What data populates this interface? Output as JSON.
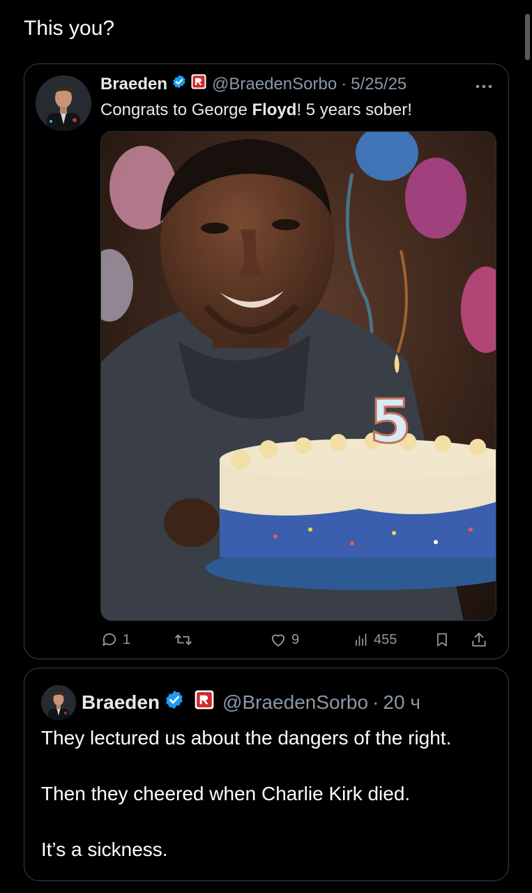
{
  "header": {
    "text": "This you?"
  },
  "quoted_tweet": {
    "author_name": "Braeden",
    "handle": "@BraedenSorbo",
    "separator": "·",
    "date": "5/25/25",
    "more_icon": "more-horizontal-icon",
    "text_prefix": "Congrats to George ",
    "text_bold": "Floyd",
    "text_suffix": "! 5 years sober!",
    "media": {
      "candle_number": "5"
    },
    "actions": {
      "replies": "1",
      "retweets": "",
      "likes": "9",
      "views": "455"
    }
  },
  "main_tweet": {
    "author_name": "Braeden",
    "handle": "@BraedenSorbo",
    "separator": "·",
    "time": "20 ч",
    "lines": [
      "They lectured us about the dangers of the right.",
      "Then they cheered when Charlie Kirk died.",
      "It’s a sickness."
    ]
  },
  "colors": {
    "background": "#000000",
    "text": "#e7e9ea",
    "muted": "#8b98a5",
    "verified": "#1d9bf0",
    "badge_red": "#e0245e",
    "border": "#3c4043"
  }
}
